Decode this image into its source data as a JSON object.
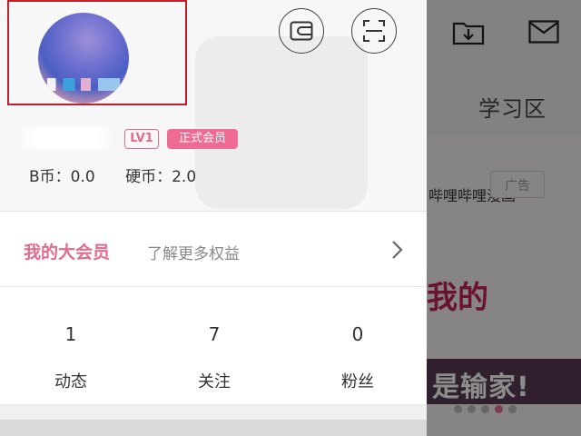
{
  "background_app": {
    "tab_label": "学习区",
    "banner_title": "哔哩哔哩漫画",
    "banner_tag": "广告",
    "banner_art_text": "我的",
    "banner_slogan": "是输家!",
    "carousel_dots": [
      false,
      false,
      false,
      true,
      false
    ],
    "icons": [
      "download-folder-icon",
      "mail-icon"
    ]
  },
  "drawer": {
    "username_redacted": true,
    "level_badge": "LV1",
    "vip_badge": "正式会员",
    "coins": {
      "b_coin": "B币：0.0",
      "hard_coin": "硬币：2.0"
    },
    "vip_row": {
      "title": "我的大会员",
      "subtitle": "了解更多权益"
    },
    "stats": [
      {
        "value": "1",
        "label": "动态"
      },
      {
        "value": "7",
        "label": "关注"
      },
      {
        "value": "0",
        "label": "粉丝"
      }
    ],
    "header_icons": [
      "wallet-icon",
      "scan-icon"
    ]
  },
  "colors": {
    "accent_pink": "#e06b8d",
    "vip_badge_bg": "#f06b93",
    "highlight_border": "#c0202a"
  }
}
